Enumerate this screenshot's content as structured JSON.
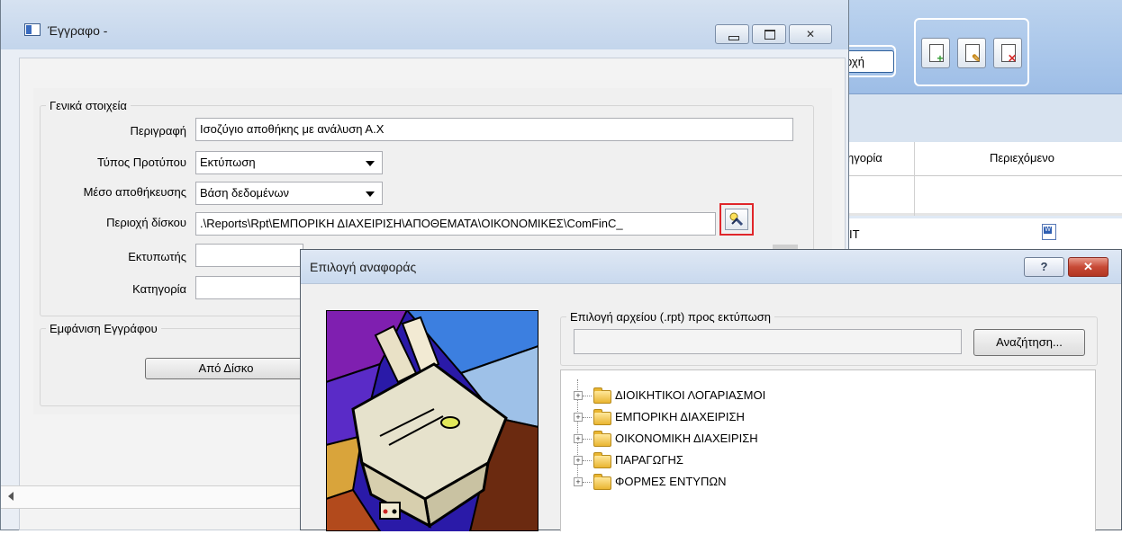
{
  "background_app": {
    "toolbar_button_label": "οχή",
    "icons": [
      "new-document-icon",
      "edit-document-icon",
      "delete-document-icon"
    ],
    "column_category": "ηγορία",
    "column_content": "Περιεχόμενο",
    "row_value": "ΙΤ"
  },
  "main_window": {
    "title": "Έγγραφο -",
    "general_group": "Γενικά στοιχεία",
    "labels": {
      "description": "Περιγραφή",
      "template_type": "Τύπος Προτύπου",
      "storage": "Μέσο αποθήκευσης",
      "disk_path": "Περιοχή δίσκου",
      "printer": "Εκτυπωτής",
      "category": "Κατηγορία"
    },
    "values": {
      "description": "Ισοζύγιο αποθήκης με ανάλυση Α.Χ",
      "template_type": "Εκτύπωση",
      "storage": "Βάση δεδομένων",
      "disk_path": ".\\Reports\\Rpt\\ΕΜΠΟΡΙΚΗ ΔΙΑΧΕΙΡΙΣΗ\\ΑΠΟΘΕΜΑΤΑ\\ΟΙΚΟΝΟΜΙΚΕΣ\\ComFinC_",
      "printer": "",
      "category": ""
    },
    "display_group": "Εμφάνιση Εγγράφου",
    "from_disk_button": "Από Δίσκο"
  },
  "dialog": {
    "title": "Επιλογή αναφοράς",
    "help_label": "?",
    "close_label": "✕",
    "file_group": "Επιλογή αρχείου (.rpt) προς εκτύπωση",
    "file_value": "",
    "search_button": "Αναζήτηση...",
    "tree": [
      {
        "label": "ΔΙΟΙΚΗΤΙΚΟΙ ΛΟΓΑΡΙΑΣΜΟΙ"
      },
      {
        "label": "ΕΜΠΟΡΙΚΗ ΔΙΑΧΕΙΡΙΣΗ"
      },
      {
        "label": "ΟΙΚΟΝΟΜΙΚΗ ΔΙΑΧΕΙΡΙΣΗ"
      },
      {
        "label": "ΠΑΡΑΓΩΓΗΣ"
      },
      {
        "label": "ΦΟΡΜΕΣ ΕΝΤΥΠΩΝ"
      }
    ]
  }
}
